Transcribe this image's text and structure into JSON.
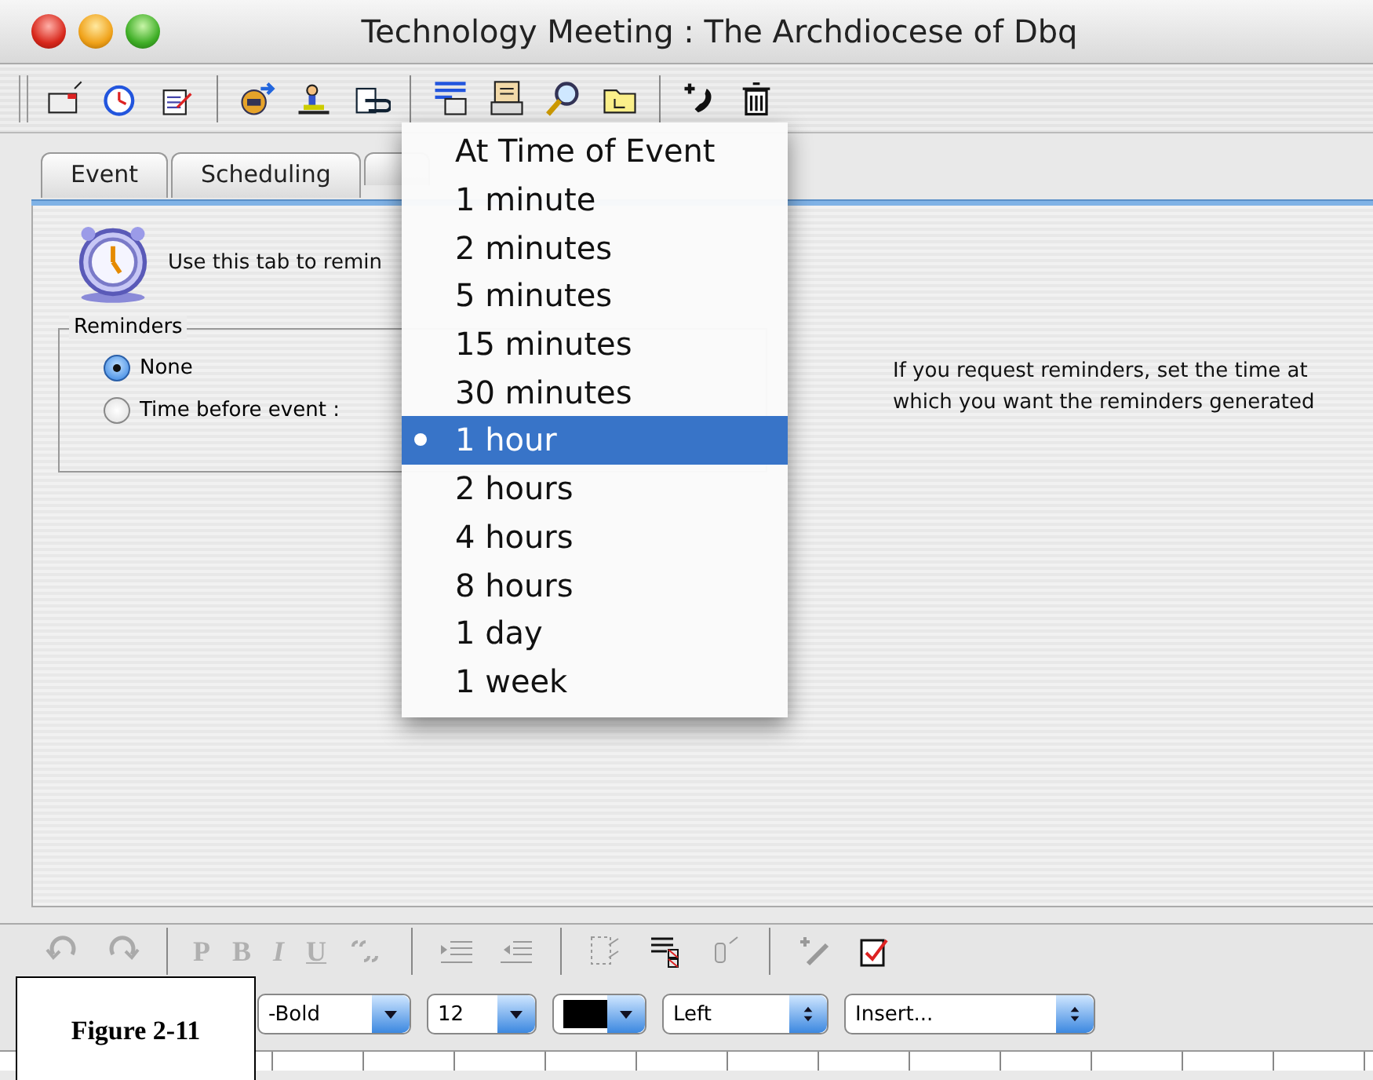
{
  "window": {
    "title": "Technology Meeting : The Archdiocese of Dbq"
  },
  "tabs": [
    {
      "label": "Event",
      "selected": false
    },
    {
      "label": "Scheduling",
      "selected": false
    }
  ],
  "intro": {
    "text": "Use this tab to remin"
  },
  "reminders": {
    "legend": "Reminders",
    "options": [
      {
        "label": "None",
        "selected": true
      },
      {
        "label": "Time before event :",
        "selected": false
      }
    ]
  },
  "help_text": "If you request reminders, set the time at which you want the reminders generated",
  "popup_menu": {
    "items": [
      {
        "label": "At Time of Event",
        "selected": false
      },
      {
        "label": "1 minute",
        "selected": false
      },
      {
        "label": "2 minutes",
        "selected": false
      },
      {
        "label": "5 minutes",
        "selected": false
      },
      {
        "label": "15 minutes",
        "selected": false
      },
      {
        "label": "30 minutes",
        "selected": false
      },
      {
        "label": "1 hour",
        "selected": true
      },
      {
        "label": "2 hours",
        "selected": false
      },
      {
        "label": "4 hours",
        "selected": false
      },
      {
        "label": "8 hours",
        "selected": false
      },
      {
        "label": "1 day",
        "selected": false
      },
      {
        "label": "1 week",
        "selected": false
      }
    ]
  },
  "format_toolbar": {
    "buttons": [
      {
        "label": "P",
        "disabled": true
      },
      {
        "label": "B",
        "disabled": true
      },
      {
        "label": "I",
        "disabled": true
      },
      {
        "label": "U",
        "disabled": true
      }
    ]
  },
  "format_bar": {
    "font": "-Bold",
    "size": "12",
    "color": "#000000",
    "align": "Left",
    "insert": "Insert..."
  },
  "figure_caption": "Figure 2-11"
}
